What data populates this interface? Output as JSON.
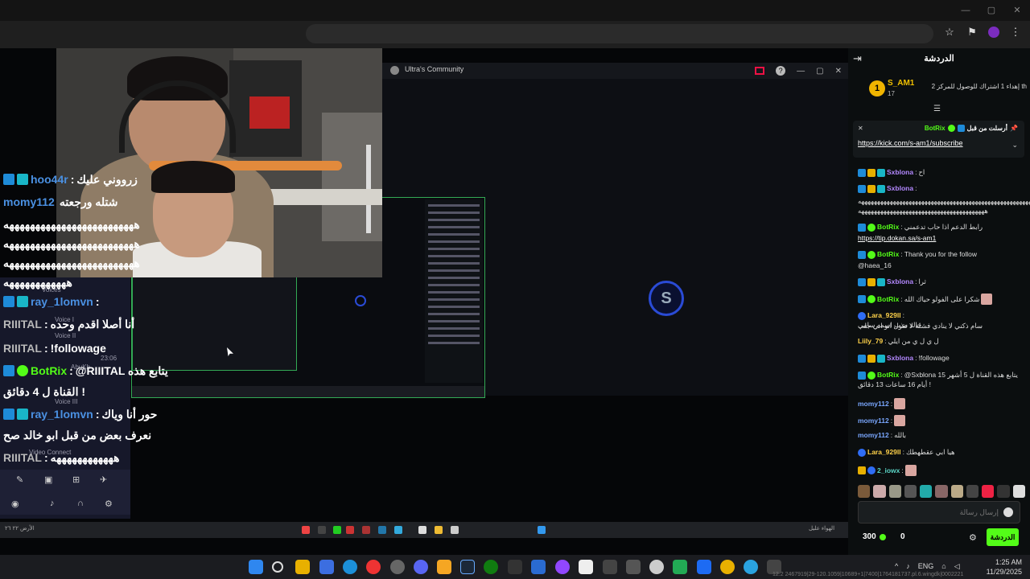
{
  "browser": {
    "window_controls": [
      "—",
      "▢",
      "✕"
    ],
    "actions": [
      "☆",
      "⚑",
      "⋮"
    ]
  },
  "share_window": {
    "title": "Ultra's Community",
    "controls": [
      "—",
      "▢",
      "✕"
    ],
    "help": "?"
  },
  "spinner_letter": "S",
  "overlay_chat": [
    {
      "user": "hoo44r",
      "sep": " : ",
      "text": "زرووني عليك",
      "badges": [
        "mod",
        "sub"
      ],
      "style": "blue"
    },
    {
      "user": "momy112",
      "sep": " ",
      "text": "شتله ورجعته",
      "badges": [],
      "style": "blue"
    },
    {
      "user": "",
      "sep": "",
      "text": "هههههههههههههههههههههههههه",
      "badges": [],
      "style": "blue"
    },
    {
      "user": "",
      "sep": "",
      "text": "هههههههههههههههههههههههههه",
      "badges": [],
      "style": "blue"
    },
    {
      "user": "",
      "sep": "",
      "text": "هههههههههههههههههههههههههه",
      "badges": [],
      "style": "blue"
    },
    {
      "user": "",
      "sep": "",
      "text": "ههههههههههههه",
      "badges": [],
      "style": "blue"
    },
    {
      "user": "ray_1lomvn",
      "sep": " : ",
      "text": "",
      "badges": [
        "mod",
        "sub"
      ],
      "style": "blue"
    },
    {
      "user": "RIIITAL",
      "sep": " : ",
      "text": "أنا أصلا اقدم وحده",
      "badges": [],
      "style": "gray"
    },
    {
      "user": "RIIITAL",
      "sep": " : ",
      "text": "!followage",
      "badges": [],
      "style": "gray"
    },
    {
      "user": "BotRix",
      "sep": " : ",
      "text": "@RIIITAL يتابع هذه",
      "badges": [
        "mod",
        "ver"
      ],
      "style": "green"
    },
    {
      "user": "",
      "sep": "",
      "text": "القناة ل 4 دقائق !",
      "badges": [],
      "style": "blue"
    },
    {
      "user": "ray_1lomvn",
      "sep": " : ",
      "text": "حور أنا وياك",
      "badges": [
        "mod",
        "sub"
      ],
      "style": "blue"
    },
    {
      "user": "",
      "sep": "",
      "text": "نعرف بعض من قبل ابو خالد صح",
      "badges": [],
      "style": "blue"
    },
    {
      "user": "RIIITAL",
      "sep": " : ",
      "text": "ههههههههههههه",
      "badges": [],
      "style": "gray"
    }
  ],
  "discord": {
    "voices_label": "Voices",
    "voice_labels": [
      "Voice I",
      "Voice II",
      "Voice III"
    ],
    "time": "23:06",
    "user": "AbuKh",
    "video_connect": "Video Connect"
  },
  "stream_taskbar_left": "الأرض ٢٢ ٢٦",
  "stream_taskbar_right": "الهواء عليل",
  "chat": {
    "title": "الدردشة",
    "top_gifter": {
      "rank": "1",
      "name": "S_AM1",
      "count": "17",
      "text": "إهداء 1 اشتراك للوصول للمركز 2 th"
    },
    "pinned": {
      "by_label": "أرسلت من قبل",
      "by_user": "BotRix",
      "link": "https://kick.com/s-am1/subscribe"
    },
    "messages": [
      {
        "user": "Sxblona",
        "text": "اح",
        "badges": [
          "mod",
          "crown",
          "sub"
        ],
        "color": "purple"
      },
      {
        "user": "Sxblona",
        "text": "",
        "badges": [
          "mod",
          "crown",
          "sub"
        ],
        "color": "purple"
      },
      {
        "user": "",
        "text": "ههههههههههههههههههههههههههههههههههههههههههههههههههههههههههههههههه",
        "badges": [],
        "color": ""
      },
      {
        "user": "",
        "text": "ههههههههههههههههههههههههههههههههههههههههه",
        "badges": [],
        "color": ""
      },
      {
        "user": "BotRix",
        "text": "رابط الدعم اذا حاب تدعمني",
        "badges": [
          "mod",
          "ver"
        ],
        "color": "green"
      },
      {
        "user": "",
        "text": "https://tip.dokan.sa/s-am1",
        "badges": [],
        "color": "",
        "link": true
      },
      {
        "user": "BotRix",
        "text": "Thank you for the follow",
        "badges": [
          "mod",
          "ver"
        ],
        "color": "green"
      },
      {
        "user": "",
        "text": "@haea_16",
        "badges": [],
        "color": ""
      },
      {
        "user": "Sxblona",
        "text": "ثرا",
        "badges": [
          "mod",
          "crown",
          "sub"
        ],
        "color": "purple"
      },
      {
        "user": "BotRix",
        "text": "شكرا على الفولو حياك الله",
        "badges": [
          "mod",
          "ver"
        ],
        "color": "green",
        "emote": true
      },
      {
        "user": "Lara_929ll",
        "text": "سام ذكني لا ينادي فشلة لا تقول انو اني جلب",
        "badges": [
          "kick"
        ],
        "color": "yellow"
      },
      {
        "user": "",
        "text": "خالد مذب اسمه سامي",
        "badges": [],
        "color": ""
      },
      {
        "user": "Liily_79",
        "text": "ل ي ل ي من ايلي",
        "badges": [],
        "color": "yellow"
      },
      {
        "user": "Sxblona",
        "text": "!followage",
        "badges": [
          "mod",
          "crown",
          "sub"
        ],
        "color": "purple"
      },
      {
        "user": "BotRix",
        "text": "@Sxblona يتابع هذه القناة ل 5 أشهر 15",
        "badges": [
          "mod",
          "ver"
        ],
        "color": "green"
      },
      {
        "user": "",
        "text": "أيام 16 ساعات 13 دقائق !",
        "badges": [],
        "color": ""
      },
      {
        "user": "momy112",
        "text": "",
        "badges": [],
        "color": "blue",
        "emote": true
      },
      {
        "user": "momy112",
        "text": "",
        "badges": [],
        "color": "blue",
        "emote": true
      },
      {
        "user": "momy112",
        "text": "بالله",
        "badges": [],
        "color": "blue"
      },
      {
        "user": "Lara_929ll",
        "text": "هيا ابي عقطهطك",
        "badges": [
          "kick"
        ],
        "color": "yellow"
      },
      {
        "user": "2_iowx",
        "text": "",
        "badges": [
          "crown",
          "kick"
        ],
        "color": "teal",
        "emote": true
      }
    ],
    "input_placeholder": "إرسال رسالة",
    "points": "300",
    "zero": "0",
    "send_label": "الدردشة"
  },
  "system": {
    "lang": "ENG",
    "time": "1:25 AM",
    "date": "11/29/2025",
    "coords": "12.2 2467919|29-120.1059|10689+1|7400|1764181737.pl.6.wingdk|0002221"
  },
  "colors": {
    "kick_green": "#53fc18",
    "mod_badge": "#1e8bd8",
    "sub_badge": "#19b6c7",
    "crown": "#e8b000"
  }
}
